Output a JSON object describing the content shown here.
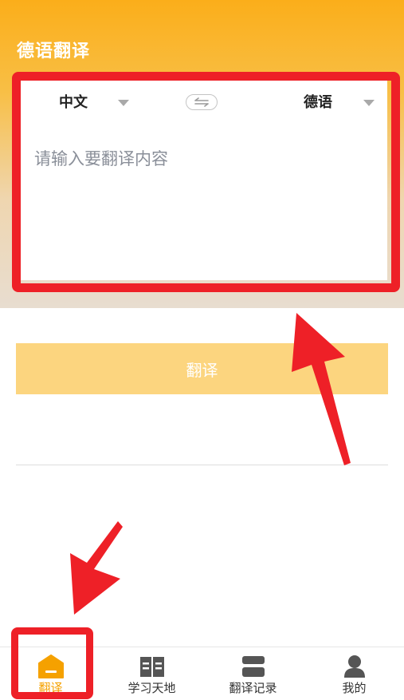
{
  "header": {
    "title": "德语翻译"
  },
  "translator": {
    "source_lang": "中文",
    "target_lang": "德语",
    "swap_icon": "swap-icon",
    "input_placeholder": "请输入要翻译内容",
    "input_value": ""
  },
  "actions": {
    "translate_label": "翻译"
  },
  "tabbar": {
    "items": [
      {
        "label": "翻译",
        "icon": "home-icon",
        "active": true
      },
      {
        "label": "学习天地",
        "icon": "book-icon",
        "active": false
      },
      {
        "label": "翻译记录",
        "icon": "records-icon",
        "active": false
      },
      {
        "label": "我的",
        "icon": "user-icon",
        "active": false
      }
    ]
  },
  "colors": {
    "accent": "#f5a100",
    "header_top": "#fbae1a",
    "button_bg": "#fcd57f",
    "annotation_red": "#ee2027",
    "tab_icon_gray": "#555555"
  }
}
